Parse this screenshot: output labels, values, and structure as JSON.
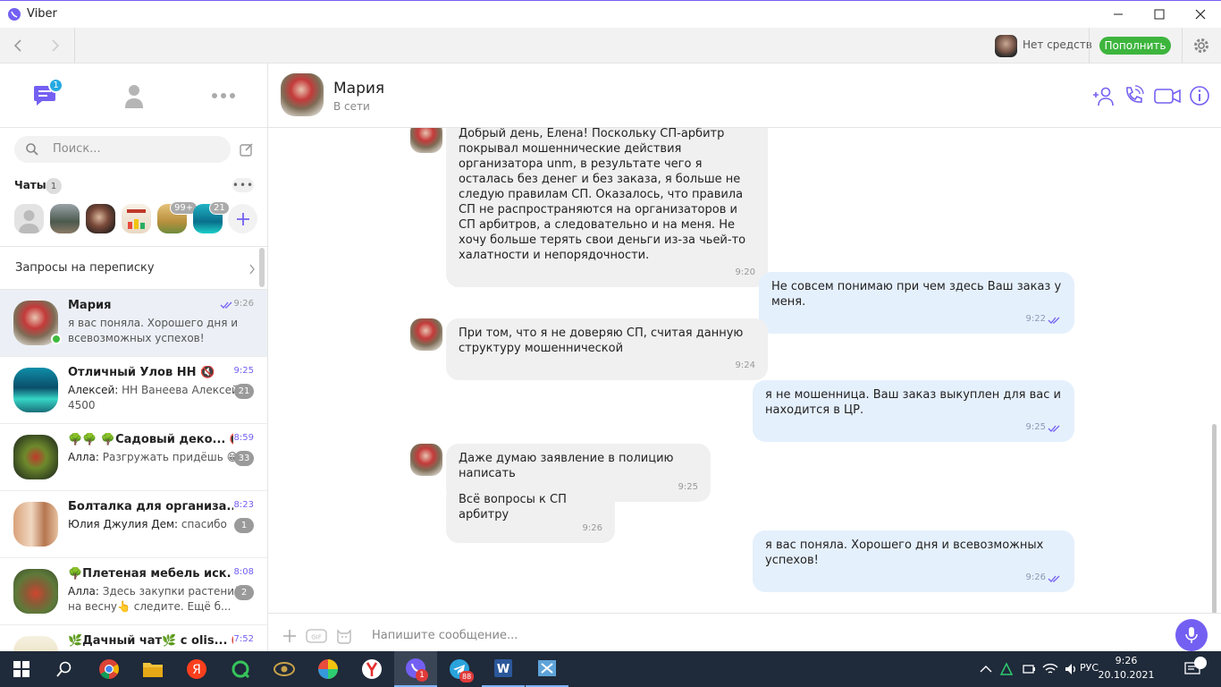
{
  "window": {
    "title": "Viber"
  },
  "toolbar": {
    "balance": "Нет средств",
    "topup_label": "Пополнить"
  },
  "left": {
    "tabs_badge": "1",
    "search_placeholder": "Поиск...",
    "chats_label": "Чаты",
    "chats_count": "1",
    "pinned": [
      {
        "badge": ""
      },
      {
        "badge": ""
      },
      {
        "badge": ""
      },
      {
        "badge": ""
      },
      {
        "badge": "99+"
      },
      {
        "badge": "21"
      }
    ],
    "requests_label": "Запросы на переписку",
    "chats": [
      {
        "name": "Мария",
        "time": "9:26",
        "sender": "",
        "msg": "я вас поняла. Хорошего дня и всевозможных успехов!",
        "count": ""
      },
      {
        "name": "Отличный Улов НН 🔇",
        "time": "9:25",
        "sender": "Алексей:",
        "msg": " НН Ванеева Алексей 4500",
        "count": "21"
      },
      {
        "name": "🌳🌳 🌳Садовый деко... 🔇",
        "time": "8:59",
        "sender": "Алла:",
        "msg": " Разгружать придёшь 😁",
        "count": "33"
      },
      {
        "name": "Болталка для организа... 🔇",
        "time": "8:23",
        "sender": "Юлия Джулия Дем:",
        "msg": " спасибо",
        "count": "1"
      },
      {
        "name": "🌳Плетеная мебель иск. ...",
        "time": "8:08",
        "sender": "Алла:",
        "msg": " Здесь закупки растений на весну👆 следите. Ещё б...",
        "count": "2"
      },
      {
        "name": "🌿Дачный чат🌿 с olis... 🔇",
        "time": "7:52",
        "sender": "",
        "msg": "",
        "count": ""
      }
    ]
  },
  "chat": {
    "name": "Мария",
    "status": "В сети",
    "messages": [
      {
        "dir": "in",
        "text": "Добрый день, Елена! Поскольку СП-арбитр покрывал мошеннические действия организатора unm, в результате чего я осталась без денег и без заказа, я больше не следую правилам СП. Оказалось, что правила СП не распространяются на организаторов и СП арбитров, а следовательно и на меня. Не хочу больше терять свои деньги из-за чьей-то халатности и непорядочности.",
        "time": "9:20"
      },
      {
        "dir": "out",
        "text": "Не совсем понимаю при чем здесь Ваш заказ у меня.",
        "time": "9:22"
      },
      {
        "dir": "in",
        "text": "При том, что я не доверяю СП, считая данную структуру мошеннической",
        "time": "9:24"
      },
      {
        "dir": "out",
        "text": "я не мошенница. Ваш заказ выкуплен для вас и находится в ЦР.",
        "time": "9:25"
      },
      {
        "dir": "in",
        "text": "Даже думаю заявление в полицию написать",
        "time": "9:25"
      },
      {
        "dir": "in",
        "text": "Всё вопросы к СП арбитру",
        "time": "9:26"
      },
      {
        "dir": "out",
        "text": "я вас поняла. Хорошего дня и всевозможных успехов!",
        "time": "9:26"
      }
    ],
    "composer_placeholder": "Напишите сообщение..."
  },
  "taskbar": {
    "lang": "РУС",
    "time": "9:26",
    "date": "20.10.2021",
    "viber_badge": "1",
    "telegram_badge": "88"
  },
  "colors": {
    "accent": "#7360f2",
    "topup": "#3db53d",
    "out_bubble": "#e5f0fd",
    "in_bubble": "#f0f0f0"
  }
}
